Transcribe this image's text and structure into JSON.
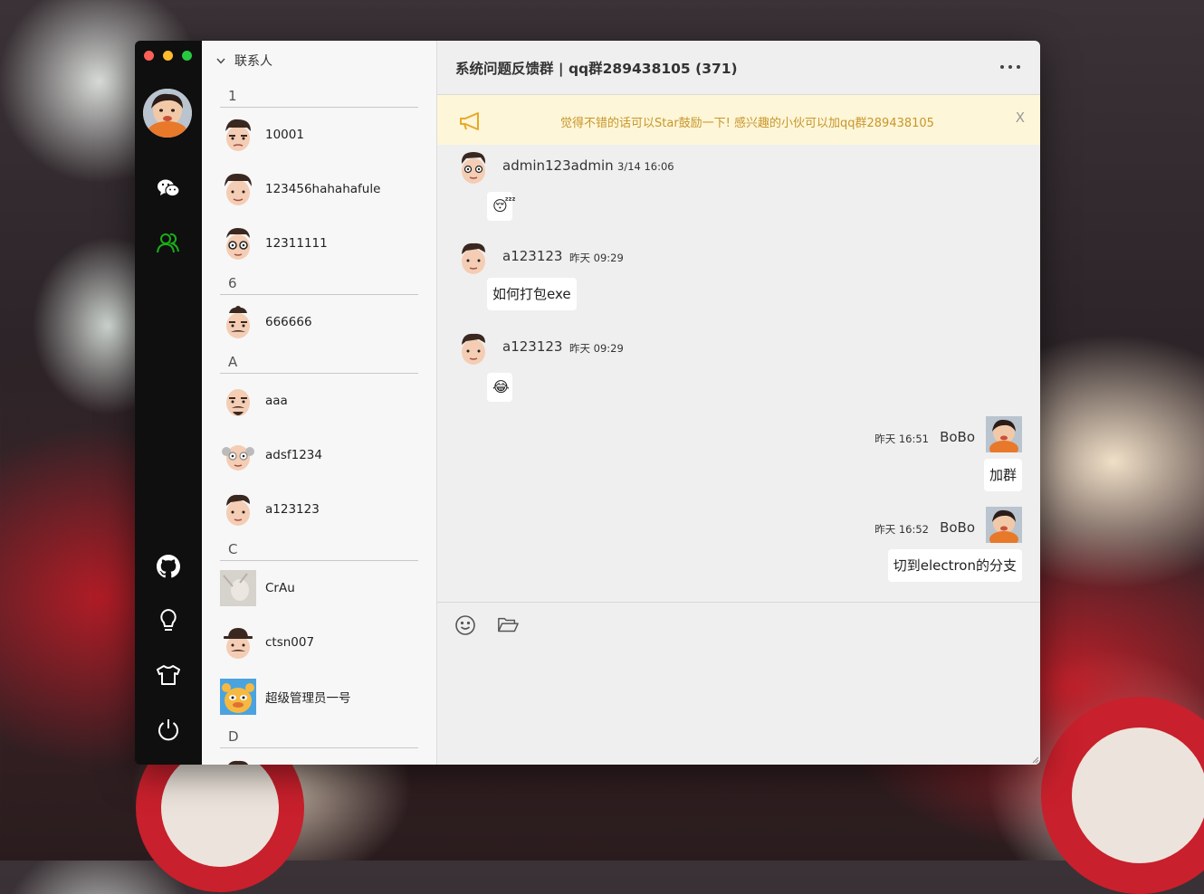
{
  "colors": {
    "traffic_red": "#fe5f57",
    "traffic_yellow": "#febc2e",
    "traffic_green": "#28c840",
    "accent_green": "#1aad19",
    "notice_text": "#c8962a",
    "notice_bg": "#fdf6d8"
  },
  "nav": {
    "icons": [
      "wechat-chat-icon",
      "contacts-icon",
      "github-icon",
      "lightbulb-icon",
      "tshirt-icon",
      "power-icon"
    ]
  },
  "contacts": {
    "header": "联系人",
    "groups": [
      {
        "letter": "1",
        "items": [
          {
            "name": "10001"
          },
          {
            "name": "123456hahahafule"
          },
          {
            "name": "12311111"
          }
        ]
      },
      {
        "letter": "6",
        "items": [
          {
            "name": "666666"
          }
        ]
      },
      {
        "letter": "A",
        "items": [
          {
            "name": "aaa"
          },
          {
            "name": "adsf1234"
          },
          {
            "name": "a123123"
          }
        ]
      },
      {
        "letter": "C",
        "items": [
          {
            "name": "CrAu"
          },
          {
            "name": "ctsn007"
          },
          {
            "name": "超级管理员一号"
          }
        ]
      },
      {
        "letter": "D",
        "items": [
          {
            "name": ""
          }
        ]
      }
    ]
  },
  "chat": {
    "title": "系统问题反馈群 | qq群289438105 (371)",
    "notice": "觉得不错的话可以Star鼓励一下! 感兴趣的小伙可以加qq群289438105",
    "notice_close": "X",
    "messages": [
      {
        "name": "admin123admin",
        "time": "3/14 16:06",
        "content": "😴"
      },
      {
        "name": "a123123",
        "time": "昨天 09:29",
        "content": "如何打包exe"
      },
      {
        "name": "a123123",
        "time": "昨天 09:29",
        "content": "😂"
      },
      {
        "name": "BoBo",
        "time": "昨天 16:51",
        "content": "加群"
      },
      {
        "name": "BoBo",
        "time": "昨天 16:52",
        "content": "切到electron的分支"
      }
    ]
  }
}
